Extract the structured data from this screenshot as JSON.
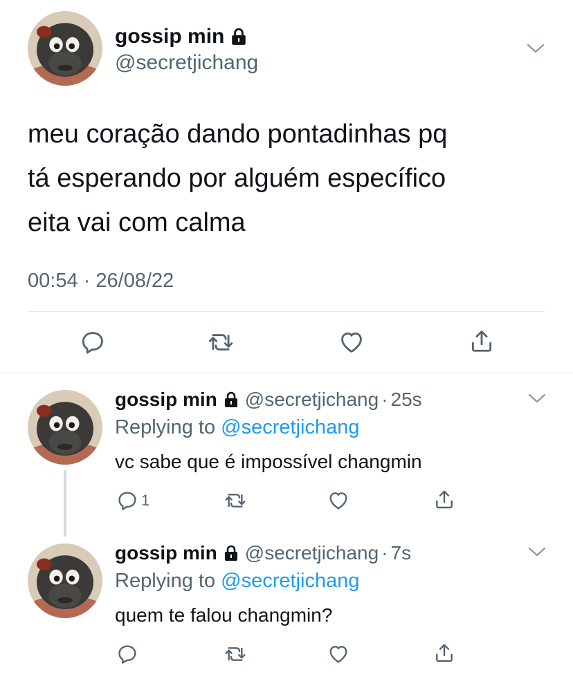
{
  "main_tweet": {
    "display_name": "gossip min",
    "handle": "@secretjichang",
    "protected_icon": "lock-icon",
    "text_lines": [
      "meu coração dando pontadinhas pq",
      "tá esperando por alguém específico",
      "eita vai com calma"
    ],
    "time": "00:54",
    "separator": "·",
    "date": "26/08/22",
    "actions": [
      "reply-icon",
      "retweet-icon",
      "like-icon",
      "share-icon"
    ]
  },
  "replies": [
    {
      "display_name": "gossip min",
      "handle": "@secretjichang",
      "separator": "·",
      "time_ago": "25s",
      "replying_prefix": "Replying to ",
      "replying_to": "@secretjichang",
      "text": "vc sabe que é impossível changmin",
      "reply_count": "1"
    },
    {
      "display_name": "gossip min",
      "handle": "@secretjichang",
      "separator": "·",
      "time_ago": "7s",
      "replying_prefix": "Replying to ",
      "replying_to": "@secretjichang",
      "text": "quem te falou changmin?",
      "reply_count": ""
    }
  ],
  "colors": {
    "text": "#0f1419",
    "secondary": "#536471",
    "link": "#1d9bf0",
    "divider": "#e6ecf0"
  }
}
